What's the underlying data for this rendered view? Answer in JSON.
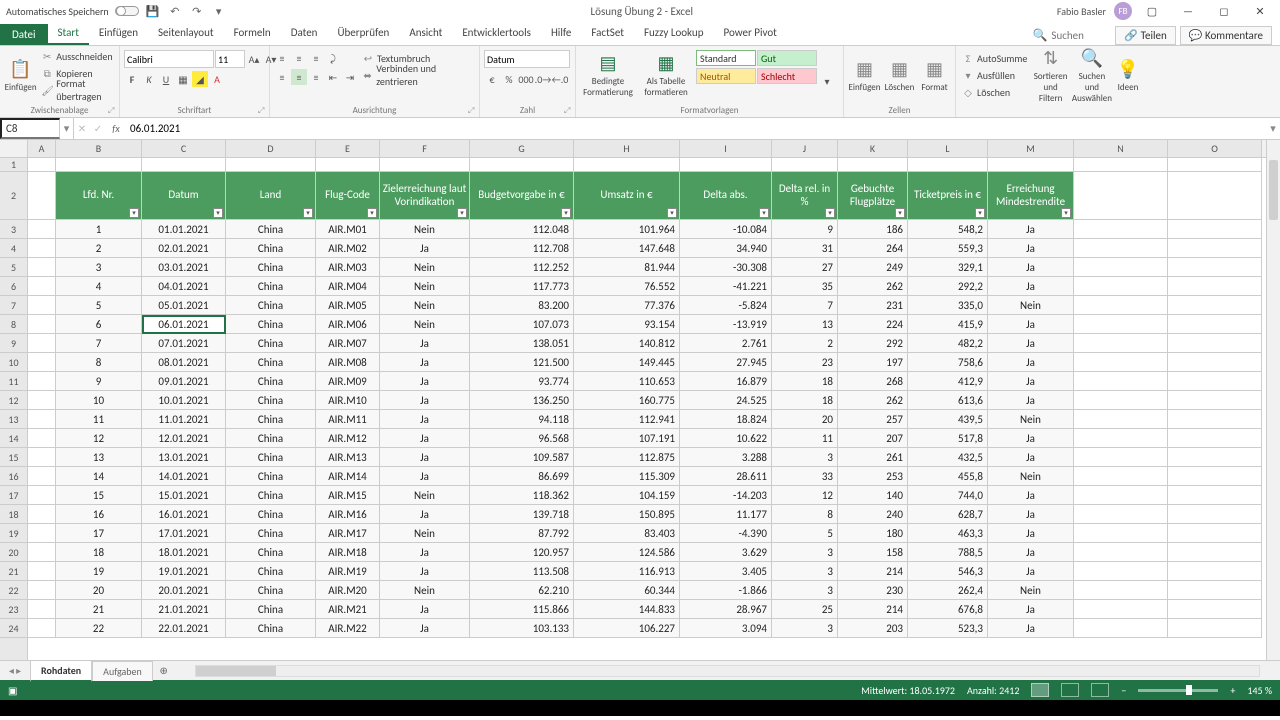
{
  "titlebar": {
    "autosave_label": "Automatisches Speichern",
    "title": "Lösung Übung 2 - Excel",
    "user_name": "Fabio Basler",
    "user_initials": "FB"
  },
  "ribbon_tabs": {
    "file": "Datei",
    "tabs": [
      "Start",
      "Einfügen",
      "Seitenlayout",
      "Formeln",
      "Daten",
      "Überprüfen",
      "Ansicht",
      "Entwicklertools",
      "Hilfe",
      "FactSet",
      "Fuzzy Lookup",
      "Power Pivot"
    ],
    "active_tab": "Start",
    "search_placeholder": "Suchen",
    "share": "Teilen",
    "comments": "Kommentare"
  },
  "ribbon_groups": {
    "clipboard": {
      "label": "Zwischenablage",
      "paste": "Einfügen",
      "cut": "Ausschneiden",
      "copy": "Kopieren",
      "painter": "Format übertragen"
    },
    "font": {
      "label": "Schriftart",
      "name": "Calibri",
      "size": "11"
    },
    "alignment": {
      "label": "Ausrichtung",
      "wrap": "Textumbruch",
      "merge": "Verbinden und zentrieren"
    },
    "number": {
      "label": "Zahl",
      "format": "Datum"
    },
    "styles": {
      "label": "Formatvorlagen",
      "cond": "Bedingte Formatierung",
      "table": "Als Tabelle formatieren",
      "standard": "Standard",
      "gut": "Gut",
      "neutral": "Neutral",
      "schlecht": "Schlecht"
    },
    "cells": {
      "label": "Zellen",
      "insert": "Einfügen",
      "delete": "Löschen",
      "format": "Format"
    },
    "editing": {
      "label": "",
      "autosum": "AutoSumme",
      "fill": "Ausfüllen",
      "clear": "Löschen",
      "sort": "Sortieren und Filtern",
      "find": "Suchen und Auswählen",
      "ideas": "Ideen"
    }
  },
  "formula_bar": {
    "name_box": "C8",
    "formula": "06.01.2021"
  },
  "columns": [
    "A",
    "B",
    "C",
    "D",
    "E",
    "F",
    "G",
    "H",
    "I",
    "J",
    "K",
    "L",
    "M",
    "N",
    "O"
  ],
  "headers": [
    "Lfd. Nr.",
    "Datum",
    "Land",
    "Flug-Code",
    "Zielerreichung laut Vorindikation",
    "Budgetvorgabe in €",
    "Umsatz in €",
    "Delta abs.",
    "Delta rel. in %",
    "Gebuchte Flugplätze",
    "Ticketpreis in €",
    "Erreichung Mindestrendite"
  ],
  "rows": [
    {
      "n": 1,
      "d": "01.01.2021",
      "l": "China",
      "fc": "AIR.M01",
      "z": "Nein",
      "b": "112.048",
      "u": "101.964",
      "da": "-10.084",
      "dr": "9",
      "gp": "186",
      "tp": "548,2",
      "er": "Ja"
    },
    {
      "n": 2,
      "d": "02.01.2021",
      "l": "China",
      "fc": "AIR.M02",
      "z": "Ja",
      "b": "112.708",
      "u": "147.648",
      "da": "34.940",
      "dr": "31",
      "gp": "264",
      "tp": "559,3",
      "er": "Ja"
    },
    {
      "n": 3,
      "d": "03.01.2021",
      "l": "China",
      "fc": "AIR.M03",
      "z": "Nein",
      "b": "112.252",
      "u": "81.944",
      "da": "-30.308",
      "dr": "27",
      "gp": "249",
      "tp": "329,1",
      "er": "Ja"
    },
    {
      "n": 4,
      "d": "04.01.2021",
      "l": "China",
      "fc": "AIR.M04",
      "z": "Nein",
      "b": "117.773",
      "u": "76.552",
      "da": "-41.221",
      "dr": "35",
      "gp": "262",
      "tp": "292,2",
      "er": "Ja"
    },
    {
      "n": 5,
      "d": "05.01.2021",
      "l": "China",
      "fc": "AIR.M05",
      "z": "Nein",
      "b": "83.200",
      "u": "77.376",
      "da": "-5.824",
      "dr": "7",
      "gp": "231",
      "tp": "335,0",
      "er": "Nein"
    },
    {
      "n": 6,
      "d": "06.01.2021",
      "l": "China",
      "fc": "AIR.M06",
      "z": "Nein",
      "b": "107.073",
      "u": "93.154",
      "da": "-13.919",
      "dr": "13",
      "gp": "224",
      "tp": "415,9",
      "er": "Ja"
    },
    {
      "n": 7,
      "d": "07.01.2021",
      "l": "China",
      "fc": "AIR.M07",
      "z": "Ja",
      "b": "138.051",
      "u": "140.812",
      "da": "2.761",
      "dr": "2",
      "gp": "292",
      "tp": "482,2",
      "er": "Ja"
    },
    {
      "n": 8,
      "d": "08.01.2021",
      "l": "China",
      "fc": "AIR.M08",
      "z": "Ja",
      "b": "121.500",
      "u": "149.445",
      "da": "27.945",
      "dr": "23",
      "gp": "197",
      "tp": "758,6",
      "er": "Ja"
    },
    {
      "n": 9,
      "d": "09.01.2021",
      "l": "China",
      "fc": "AIR.M09",
      "z": "Ja",
      "b": "93.774",
      "u": "110.653",
      "da": "16.879",
      "dr": "18",
      "gp": "268",
      "tp": "412,9",
      "er": "Ja"
    },
    {
      "n": 10,
      "d": "10.01.2021",
      "l": "China",
      "fc": "AIR.M10",
      "z": "Ja",
      "b": "136.250",
      "u": "160.775",
      "da": "24.525",
      "dr": "18",
      "gp": "262",
      "tp": "613,6",
      "er": "Ja"
    },
    {
      "n": 11,
      "d": "11.01.2021",
      "l": "China",
      "fc": "AIR.M11",
      "z": "Ja",
      "b": "94.118",
      "u": "112.941",
      "da": "18.824",
      "dr": "20",
      "gp": "257",
      "tp": "439,5",
      "er": "Nein"
    },
    {
      "n": 12,
      "d": "12.01.2021",
      "l": "China",
      "fc": "AIR.M12",
      "z": "Ja",
      "b": "96.568",
      "u": "107.191",
      "da": "10.622",
      "dr": "11",
      "gp": "207",
      "tp": "517,8",
      "er": "Ja"
    },
    {
      "n": 13,
      "d": "13.01.2021",
      "l": "China",
      "fc": "AIR.M13",
      "z": "Ja",
      "b": "109.587",
      "u": "112.875",
      "da": "3.288",
      "dr": "3",
      "gp": "261",
      "tp": "432,5",
      "er": "Ja"
    },
    {
      "n": 14,
      "d": "14.01.2021",
      "l": "China",
      "fc": "AIR.M14",
      "z": "Ja",
      "b": "86.699",
      "u": "115.309",
      "da": "28.611",
      "dr": "33",
      "gp": "253",
      "tp": "455,8",
      "er": "Nein"
    },
    {
      "n": 15,
      "d": "15.01.2021",
      "l": "China",
      "fc": "AIR.M15",
      "z": "Nein",
      "b": "118.362",
      "u": "104.159",
      "da": "-14.203",
      "dr": "12",
      "gp": "140",
      "tp": "744,0",
      "er": "Ja"
    },
    {
      "n": 16,
      "d": "16.01.2021",
      "l": "China",
      "fc": "AIR.M16",
      "z": "Ja",
      "b": "139.718",
      "u": "150.895",
      "da": "11.177",
      "dr": "8",
      "gp": "240",
      "tp": "628,7",
      "er": "Ja"
    },
    {
      "n": 17,
      "d": "17.01.2021",
      "l": "China",
      "fc": "AIR.M17",
      "z": "Nein",
      "b": "87.792",
      "u": "83.403",
      "da": "-4.390",
      "dr": "5",
      "gp": "180",
      "tp": "463,3",
      "er": "Ja"
    },
    {
      "n": 18,
      "d": "18.01.2021",
      "l": "China",
      "fc": "AIR.M18",
      "z": "Ja",
      "b": "120.957",
      "u": "124.586",
      "da": "3.629",
      "dr": "3",
      "gp": "158",
      "tp": "788,5",
      "er": "Ja"
    },
    {
      "n": 19,
      "d": "19.01.2021",
      "l": "China",
      "fc": "AIR.M19",
      "z": "Ja",
      "b": "113.508",
      "u": "116.913",
      "da": "3.405",
      "dr": "3",
      "gp": "214",
      "tp": "546,3",
      "er": "Ja"
    },
    {
      "n": 20,
      "d": "20.01.2021",
      "l": "China",
      "fc": "AIR.M20",
      "z": "Nein",
      "b": "62.210",
      "u": "60.344",
      "da": "-1.866",
      "dr": "3",
      "gp": "230",
      "tp": "262,4",
      "er": "Nein"
    },
    {
      "n": 21,
      "d": "21.01.2021",
      "l": "China",
      "fc": "AIR.M21",
      "z": "Ja",
      "b": "115.866",
      "u": "144.833",
      "da": "28.967",
      "dr": "25",
      "gp": "214",
      "tp": "676,8",
      "er": "Ja"
    },
    {
      "n": 22,
      "d": "22.01.2021",
      "l": "China",
      "fc": "AIR.M22",
      "z": "Ja",
      "b": "103.133",
      "u": "106.227",
      "da": "3.094",
      "dr": "3",
      "gp": "203",
      "tp": "523,3",
      "er": "Ja"
    }
  ],
  "sheet_tabs": {
    "active": "Rohdaten",
    "other": "Aufgaben"
  },
  "statusbar": {
    "avg_label": "Mittelwert:",
    "avg": "18.05.1972",
    "count_label": "Anzahl:",
    "count": "2412",
    "zoom": "145 %"
  },
  "col_widths_classes": [
    "cB",
    "cC",
    "cD",
    "cE",
    "cF",
    "cG",
    "cH",
    "cI",
    "cJ",
    "cK",
    "cL",
    "cM"
  ]
}
